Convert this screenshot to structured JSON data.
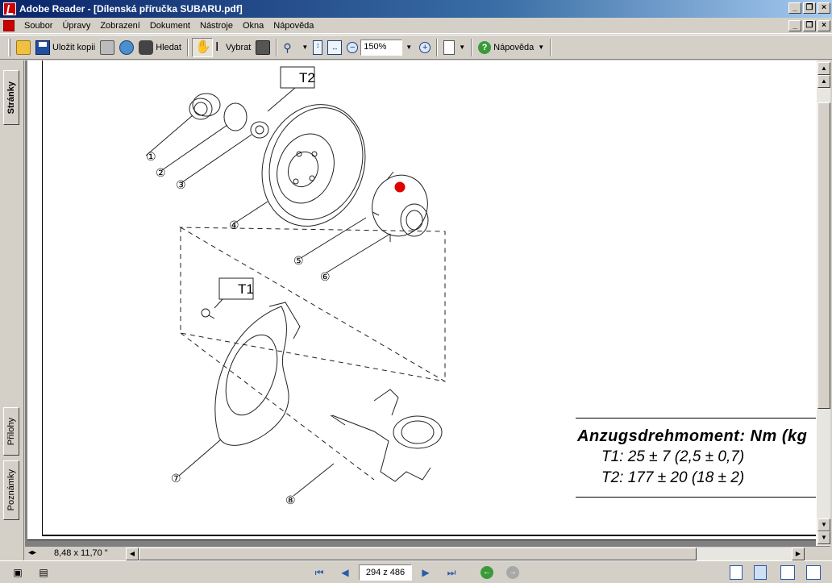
{
  "window": {
    "title": "Adobe Reader - [Dílenská příručka SUBARU.pdf]",
    "controls": [
      "_",
      "❐",
      "×"
    ]
  },
  "menu": {
    "items": [
      "Soubor",
      "Úpravy",
      "Zobrazení",
      "Dokument",
      "Nástroje",
      "Okna",
      "Nápověda"
    ]
  },
  "toolbar": {
    "save_copy_label": "Uložit kopii",
    "search_label": "Hledat",
    "select_label": "Vybrat",
    "zoom_value": "150%",
    "help_label": "Nápověda"
  },
  "side_tabs": {
    "pages": "Stránky",
    "attachments": "Přílohy",
    "comments": "Poznámky"
  },
  "document": {
    "callouts": {
      "t2": "T2",
      "t1": "T1"
    },
    "part_numbers": [
      "①",
      "②",
      "③",
      "④",
      "⑤",
      "⑥",
      "⑦",
      "⑧"
    ],
    "legend": {
      "title": "Anzugsdrehmoment: Nm (kg",
      "line1": "T1: 25 ± 7 (2,5 ± 0,7)",
      "line2": "T2: 177 ± 20 (18 ± 2)"
    },
    "marker_color": "#e00000"
  },
  "status": {
    "page_size": "8,48 x 11,70 \"",
    "page_indicator": "294 z 486"
  }
}
